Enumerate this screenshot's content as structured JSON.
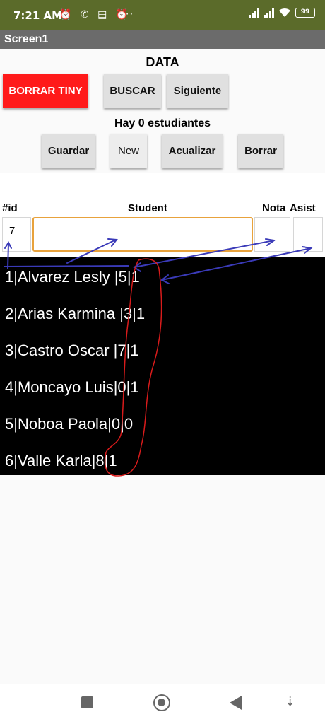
{
  "status_bar": {
    "time": "7:21 AM",
    "notification_icons": "⏰ ✆ ▤ ⏰",
    "more": "···",
    "battery": "99"
  },
  "title_bar": {
    "title": "Screen1"
  },
  "heading": "DATA",
  "buttons": {
    "borrar_tiny": "BORRAR TINY",
    "buscar": "BUSCAR",
    "siguiente": "Siguiente",
    "guardar": "Guardar",
    "new": "New",
    "actualizar": "Acualizar",
    "borrar": "Borrar"
  },
  "count_label": "Hay 0 estudiantes",
  "form": {
    "id_label": "#id",
    "student_label": "Student",
    "nota_label": "Nota",
    "asist_label": "Asist",
    "id_value": "7",
    "student_value": "",
    "nota_value": "",
    "asist_value": ""
  },
  "students": [
    "1|Alvarez Lesly |5|1",
    "2|Arias Karmina |3|1",
    "3|Castro Oscar |7|1",
    "4|Moncayo Luis|0|1",
    "5|Noboa Paola|0|0",
    "6|Valle Karla|8|1"
  ],
  "colors": {
    "status_bar": "#5b6b2a",
    "title_bar": "#6b6b6b",
    "red_button": "#ff1a1a",
    "focus_border": "#e8a23c",
    "annotation_blue": "#3a3ab8",
    "annotation_red": "#d81b1b"
  },
  "nav_icons": [
    "recent-apps-icon",
    "home-icon",
    "back-icon",
    "gesture-down-icon"
  ]
}
